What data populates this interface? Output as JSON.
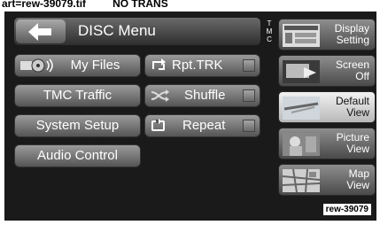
{
  "caption": {
    "art": "art=rew-39079.tif",
    "note": "NO TRANS"
  },
  "header": {
    "title": "DISC Menu",
    "back_icon": "arrow-left-icon",
    "tmc_letters": "T\nM\nC"
  },
  "left_buttons": [
    {
      "label": "My Files",
      "icon": "media-files-icon"
    },
    {
      "label": "TMC Traffic"
    },
    {
      "label": "System Setup"
    },
    {
      "label": "Audio Control"
    }
  ],
  "mid_buttons": [
    {
      "label": "Rpt.TRK",
      "icon": "repeat-track-icon",
      "checked": false
    },
    {
      "label": "Shuffle",
      "icon": "shuffle-icon",
      "checked": false
    },
    {
      "label": "Repeat",
      "icon": "repeat-icon",
      "checked": false
    }
  ],
  "side_buttons": [
    {
      "label": "Display\nSetting",
      "icon": "display-setting-thumbnail",
      "active": false
    },
    {
      "label": "Screen\nOff",
      "icon": "screen-off-thumbnail",
      "active": false
    },
    {
      "label": "Default\nView",
      "icon": "default-view-thumbnail",
      "active": true
    },
    {
      "label": "Picture\nView",
      "icon": "picture-view-thumbnail",
      "active": false
    },
    {
      "label": "Map\nView",
      "icon": "map-view-thumbnail",
      "active": false
    }
  ],
  "code_label": "rew-39079"
}
